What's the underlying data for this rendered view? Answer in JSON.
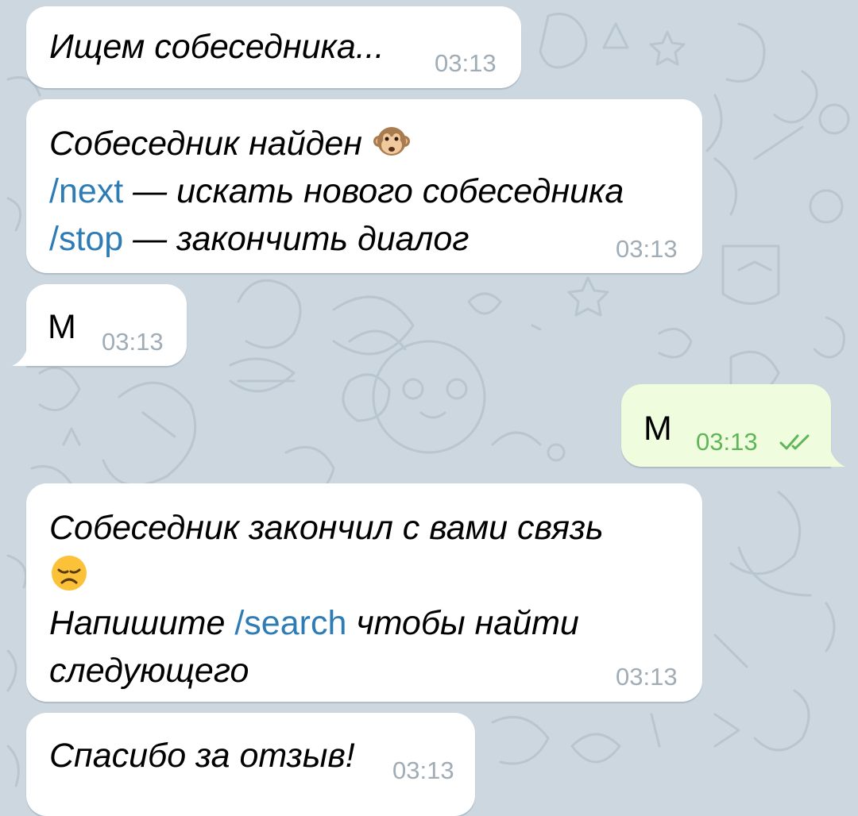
{
  "chat": {
    "colors": {
      "background": "#ccd7df",
      "incoming_bubble": "#ffffff",
      "outgoing_bubble": "#effdde",
      "command_link": "#2e7cb6",
      "incoming_time": "#a0acb6",
      "outgoing_time": "#5fb557"
    },
    "messages": [
      {
        "direction": "incoming",
        "text": "Ищем собеседника...",
        "time": "03:13"
      },
      {
        "direction": "incoming",
        "line1_text": "Собеседник найден",
        "line1_emoji": "monkey-face-icon",
        "line2_command": "/next",
        "line2_text": " — искать нового собеседника",
        "line3_command": "/stop",
        "line3_text": " — закончить диалог",
        "time": "03:13"
      },
      {
        "direction": "incoming",
        "text": "М",
        "time": "03:13"
      },
      {
        "direction": "outgoing",
        "text": "М",
        "time": "03:13",
        "status_icon": "double-check-icon"
      },
      {
        "direction": "incoming",
        "line1_text": "Собеседник закончил с вами связь",
        "line2_emoji": "disappointed-face-icon",
        "line3_text_before": "Напишите ",
        "line3_command": "/search",
        "line3_text_after": " чтобы найти",
        "line4_text": "следующего",
        "time": "03:13"
      },
      {
        "direction": "incoming",
        "text": "Спасибо за отзыв!",
        "time": "03:13"
      }
    ]
  }
}
